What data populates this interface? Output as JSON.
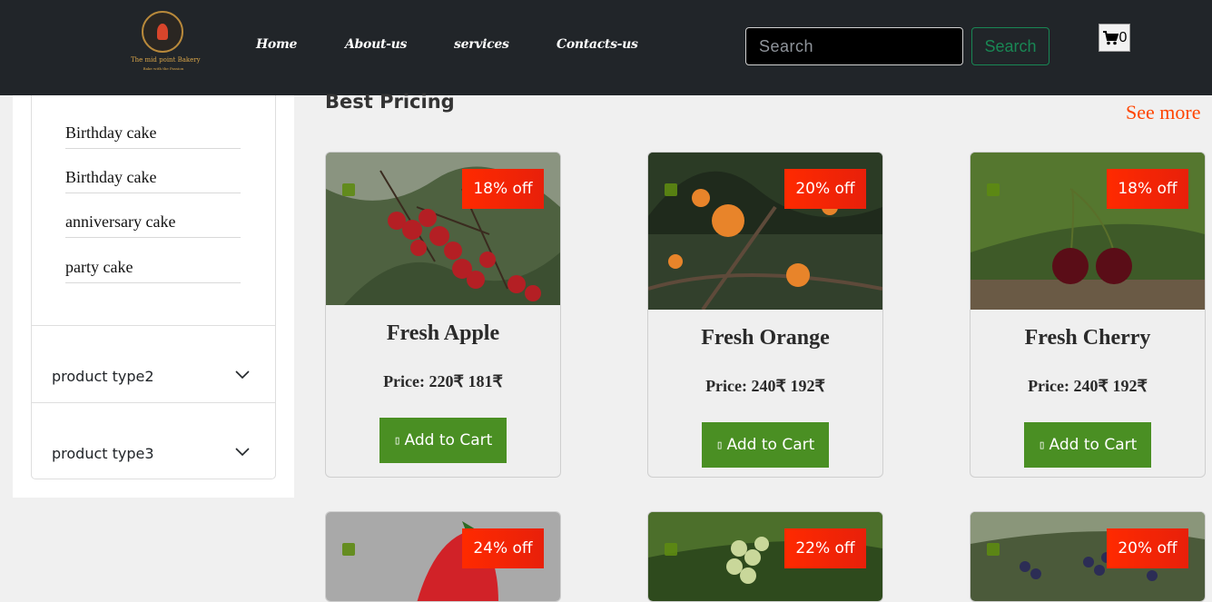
{
  "brand": {
    "name": "The mid point Bakery",
    "tagline": "Bake with the Passion"
  },
  "nav": {
    "items": [
      {
        "label": "Home"
      },
      {
        "label": "About-us"
      },
      {
        "label": "services"
      },
      {
        "label": "Contacts-us"
      }
    ]
  },
  "search": {
    "placeholder": "Search",
    "button": "Search"
  },
  "cart": {
    "count": "0"
  },
  "sidebar": {
    "sub_items": [
      {
        "label": "Birthday cake"
      },
      {
        "label": "Birthday cake"
      },
      {
        "label": "anniversary cake"
      },
      {
        "label": "party cake"
      }
    ],
    "sections": [
      {
        "label": "product type2"
      },
      {
        "label": "product type3"
      }
    ]
  },
  "main": {
    "title": "Best Pricing",
    "see_more": "See more",
    "cards": [
      {
        "name": "Fresh Apple",
        "price": "Price: 220₹ 181₹",
        "discount": "18% off",
        "button": "Add to Cart"
      },
      {
        "name": "Fresh Orange",
        "price": "Price: 240₹ 192₹",
        "discount": "20% off",
        "button": "Add to Cart"
      },
      {
        "name": "Fresh Cherry",
        "price": "Price: 240₹ 192₹",
        "discount": "18% off",
        "button": "Add to Cart"
      },
      {
        "name": "",
        "price": "",
        "discount": "24% off",
        "button": ""
      },
      {
        "name": "",
        "price": "",
        "discount": "22% off",
        "button": ""
      },
      {
        "name": "",
        "price": "",
        "discount": "20% off",
        "button": ""
      }
    ]
  },
  "icons": {
    "cart": "cart-icon",
    "chevron": "chevron-down-icon",
    "button_icon": "cart-small-icon"
  },
  "colors": {
    "navbar": "#212529",
    "accent_green": "#198754",
    "button_green": "#4a8f23",
    "discount_red": "#ff2a00",
    "see_more": "#ff4500"
  }
}
